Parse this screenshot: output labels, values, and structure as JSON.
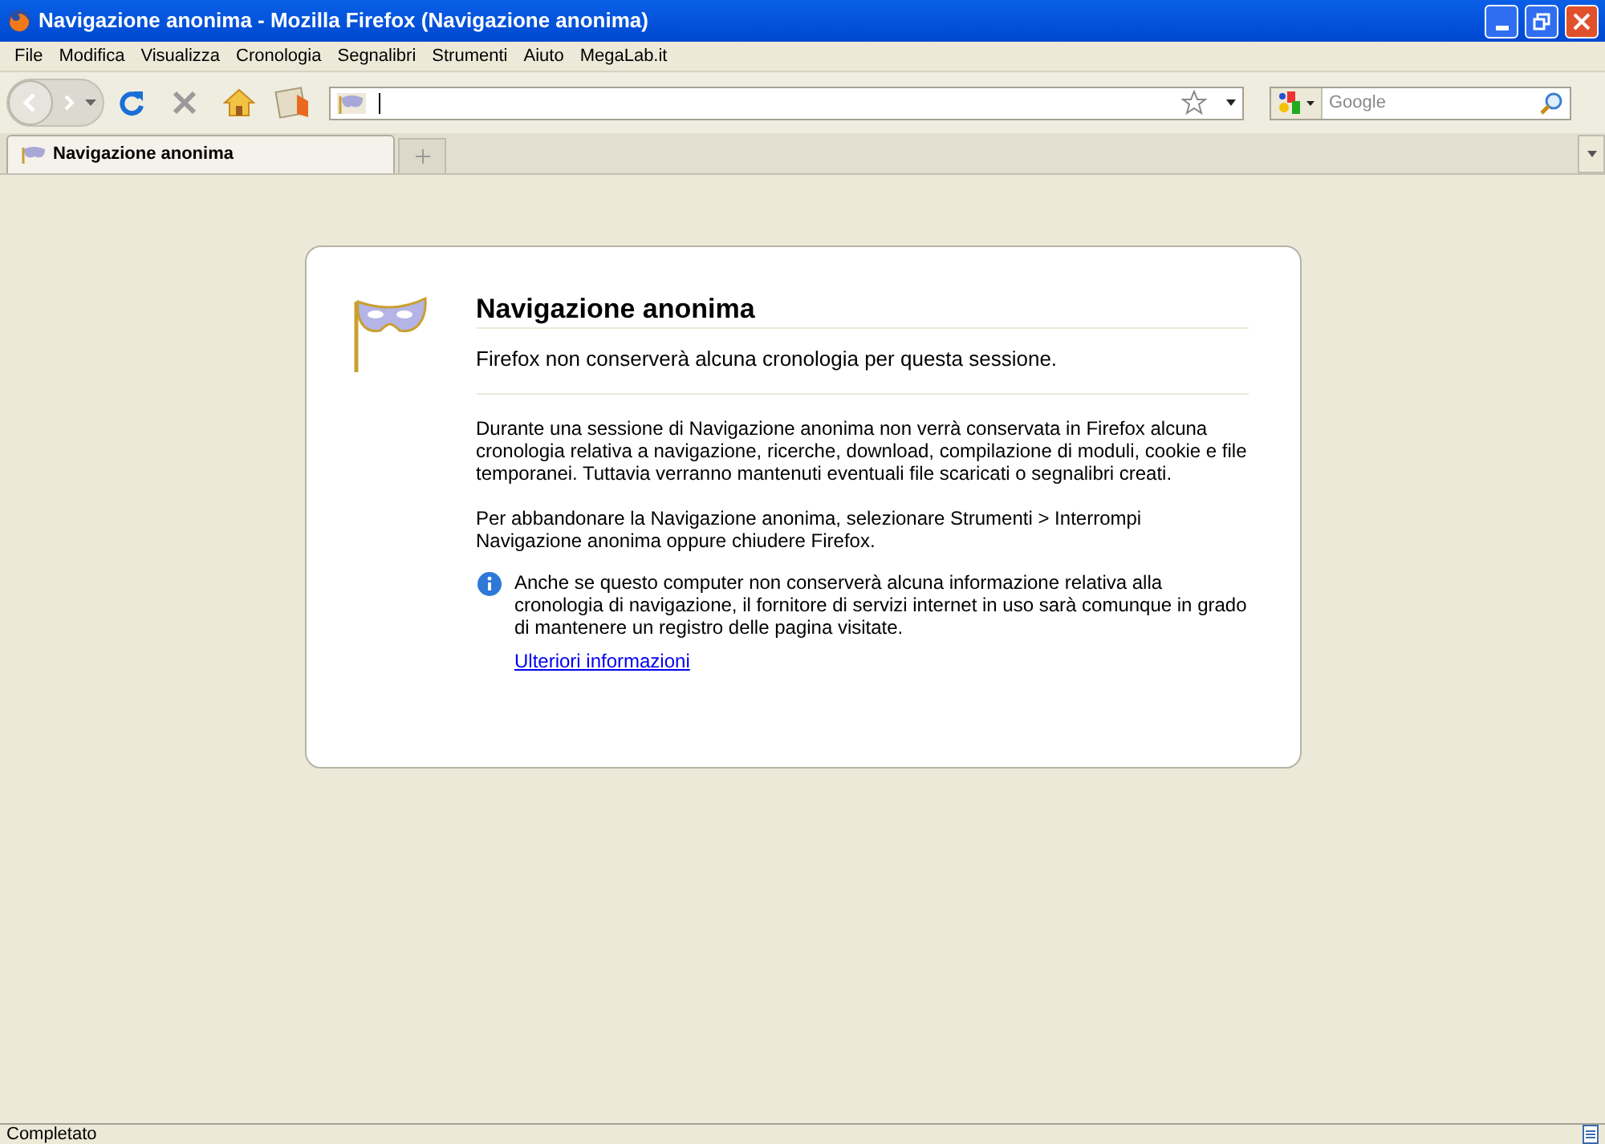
{
  "window": {
    "title": "Navigazione anonima - Mozilla Firefox (Navigazione anonima)"
  },
  "menu": [
    "File",
    "Modifica",
    "Visualizza",
    "Cronologia",
    "Segnalibri",
    "Strumenti",
    "Aiuto",
    "MegaLab.it"
  ],
  "search": {
    "placeholder": "Google"
  },
  "tabs": [
    {
      "label": "Navigazione anonima",
      "selected": true
    }
  ],
  "page": {
    "title": "Navigazione anonima",
    "subtitle": "Firefox non conserverà alcuna cronologia per questa sessione.",
    "paragraphs": [
      "Durante una sessione di Navigazione anonima non verrà conservata in Firefox alcuna cronologia relativa a navigazione, ricerche, download, compilazione di moduli, cookie e file temporanei. Tuttavia verranno mantenuti eventuali file scaricati o segnalibri creati.",
      "Per abbandonare la Navigazione anonima, selezionare Strumenti > Interrompi Navigazione anonima oppure chiudere Firefox."
    ],
    "info": "Anche se questo computer non conserverà alcuna informazione relativa alla cronologia di navigazione, il fornitore di servizi internet in uso sarà comunque in grado di mantenere un registro delle pagina visitate.",
    "link": "Ulteriori informazioni"
  },
  "status_bar": {
    "text": "Completato"
  }
}
